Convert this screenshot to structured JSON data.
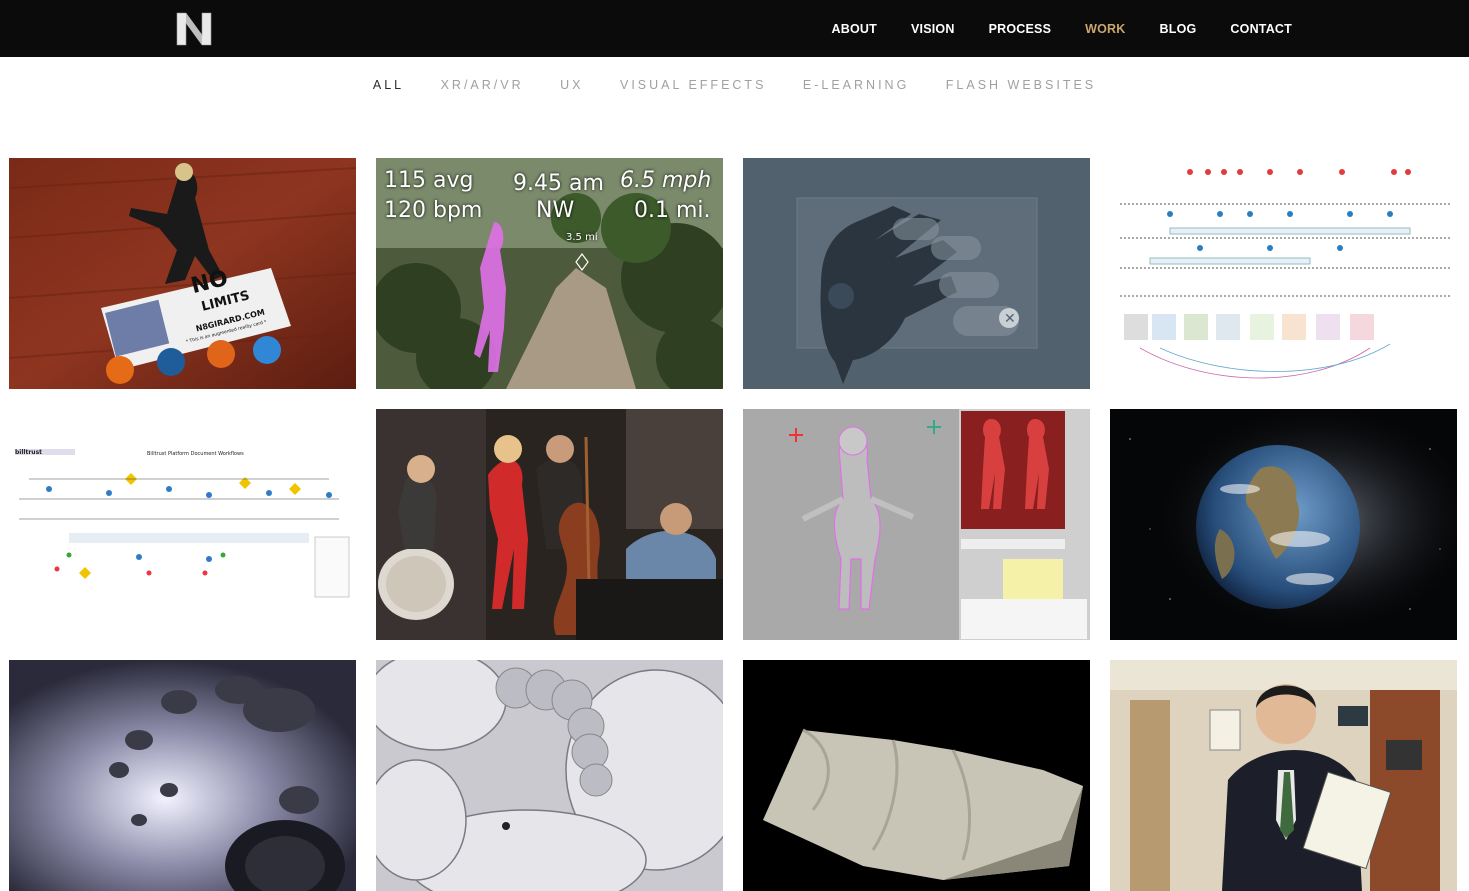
{
  "brand": {
    "logo_letter": "N"
  },
  "nav": [
    {
      "label": "ABOUT",
      "active": false
    },
    {
      "label": "VISION",
      "active": false
    },
    {
      "label": "PROCESS",
      "active": false
    },
    {
      "label": "WORK",
      "active": true
    },
    {
      "label": "BLOG",
      "active": false
    },
    {
      "label": "CONTACT",
      "active": false
    }
  ],
  "filters": [
    {
      "label": "ALL",
      "active": true
    },
    {
      "label": "XR/AR/VR",
      "active": false
    },
    {
      "label": "UX",
      "active": false
    },
    {
      "label": "VISUAL EFFECTS",
      "active": false
    },
    {
      "label": "E-LEARNING",
      "active": false
    },
    {
      "label": "FLASH WEBSITES",
      "active": false
    }
  ],
  "portfolio": {
    "ar_card": {
      "line1": "NO",
      "line2": "LIMITS",
      "url": "N8GIRARD.COM",
      "note": "* This is an augmented reality card *"
    },
    "run_hud": {
      "avg": "115 avg",
      "bpm": "120 bpm",
      "time": "9.45 am",
      "dir": "NW",
      "speed": "6.5 mph",
      "dist": "0.1 mi.",
      "marker": "3.5 mi"
    },
    "workflow": {
      "brand": "billtrust",
      "title": "Billtrust Platform Document Workflows"
    },
    "colors": {
      "accent_gold": "#c9a66b",
      "bar": "#0b0b0b",
      "hud_pink": "#e070e8"
    }
  }
}
